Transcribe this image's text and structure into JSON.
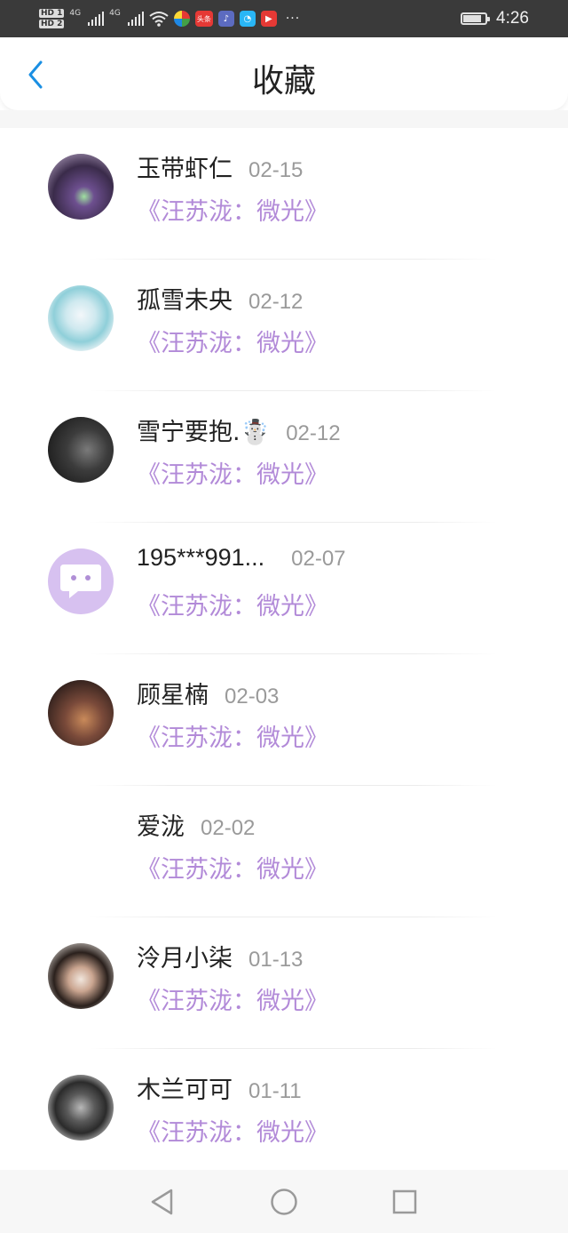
{
  "status_bar": {
    "network_left": "4G",
    "network_right": "4G",
    "hd1": "HD",
    "hd2": "HD",
    "hd1_sub": "1",
    "hd2_sub": "2",
    "toutiao_label": "头条",
    "more": "···",
    "time": "4:26",
    "battery_level": 0.85
  },
  "header": {
    "back_icon": "chevron-left-icon",
    "title": "收藏",
    "accent": "#1a8fe3"
  },
  "favorites": [
    {
      "name": "玉带虾仁",
      "date": "02-15",
      "subtitle": "《汪苏泷：微光》",
      "avatar": "avatar-art-figure"
    },
    {
      "name": "孤雪未央",
      "date": "02-12",
      "subtitle": "《汪苏泷：微光》",
      "avatar": "avatar-watercolor"
    },
    {
      "name": "雪宁要抱.☃️",
      "date": "02-12",
      "subtitle": "《汪苏泷：微光》",
      "avatar": "avatar-dark-portrait"
    },
    {
      "name": "195***991...",
      "date": "02-07",
      "subtitle": "《汪苏泷：微光》",
      "avatar": "default-chat-bubble-icon"
    },
    {
      "name": "顾星楠",
      "date": "02-03",
      "subtitle": "《汪苏泷：微光》",
      "avatar": "avatar-portrait-warm"
    },
    {
      "name": "爱泷",
      "date": "02-02",
      "subtitle": "《汪苏泷：微光》",
      "avatar": ""
    },
    {
      "name": "泠月小柒",
      "date": "01-13",
      "subtitle": "《汪苏泷：微光》",
      "avatar": "avatar-girl-portrait"
    },
    {
      "name": "木兰可可",
      "date": "01-11",
      "subtitle": "《汪苏泷：微光》",
      "avatar": "avatar-tea-leaves"
    }
  ],
  "colors": {
    "subtitle": "#b28ad8",
    "date": "#9a9a9a",
    "default_avatar_bg": "#d7c1f0"
  },
  "nav_bar": {
    "back": "triangle-back-icon",
    "home": "circle-home-icon",
    "recents": "square-recents-icon"
  }
}
